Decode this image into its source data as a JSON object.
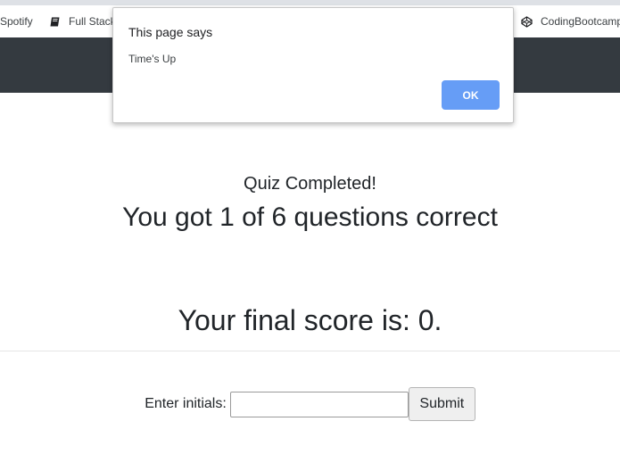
{
  "bookmarks": [
    {
      "label": "Spotify",
      "icon": "spotify-icon"
    },
    {
      "label": "Full Stack",
      "icon": "book-icon"
    },
    {
      "label": "CodingBootcamp",
      "icon": "codepen-icon"
    }
  ],
  "quiz": {
    "completed_label": "Quiz Completed!",
    "correct_line": "You got 1 of 6 questions correct",
    "final_score": "Your final score is: 0."
  },
  "form": {
    "initials_label": "Enter initials:",
    "initials_value": "",
    "submit_label": "Submit"
  },
  "dialog": {
    "title": "This page says",
    "message": "Time's Up",
    "ok_label": "OK"
  },
  "colors": {
    "navbar": "#343a40",
    "ok_button": "#669df6",
    "text": "#212529"
  }
}
